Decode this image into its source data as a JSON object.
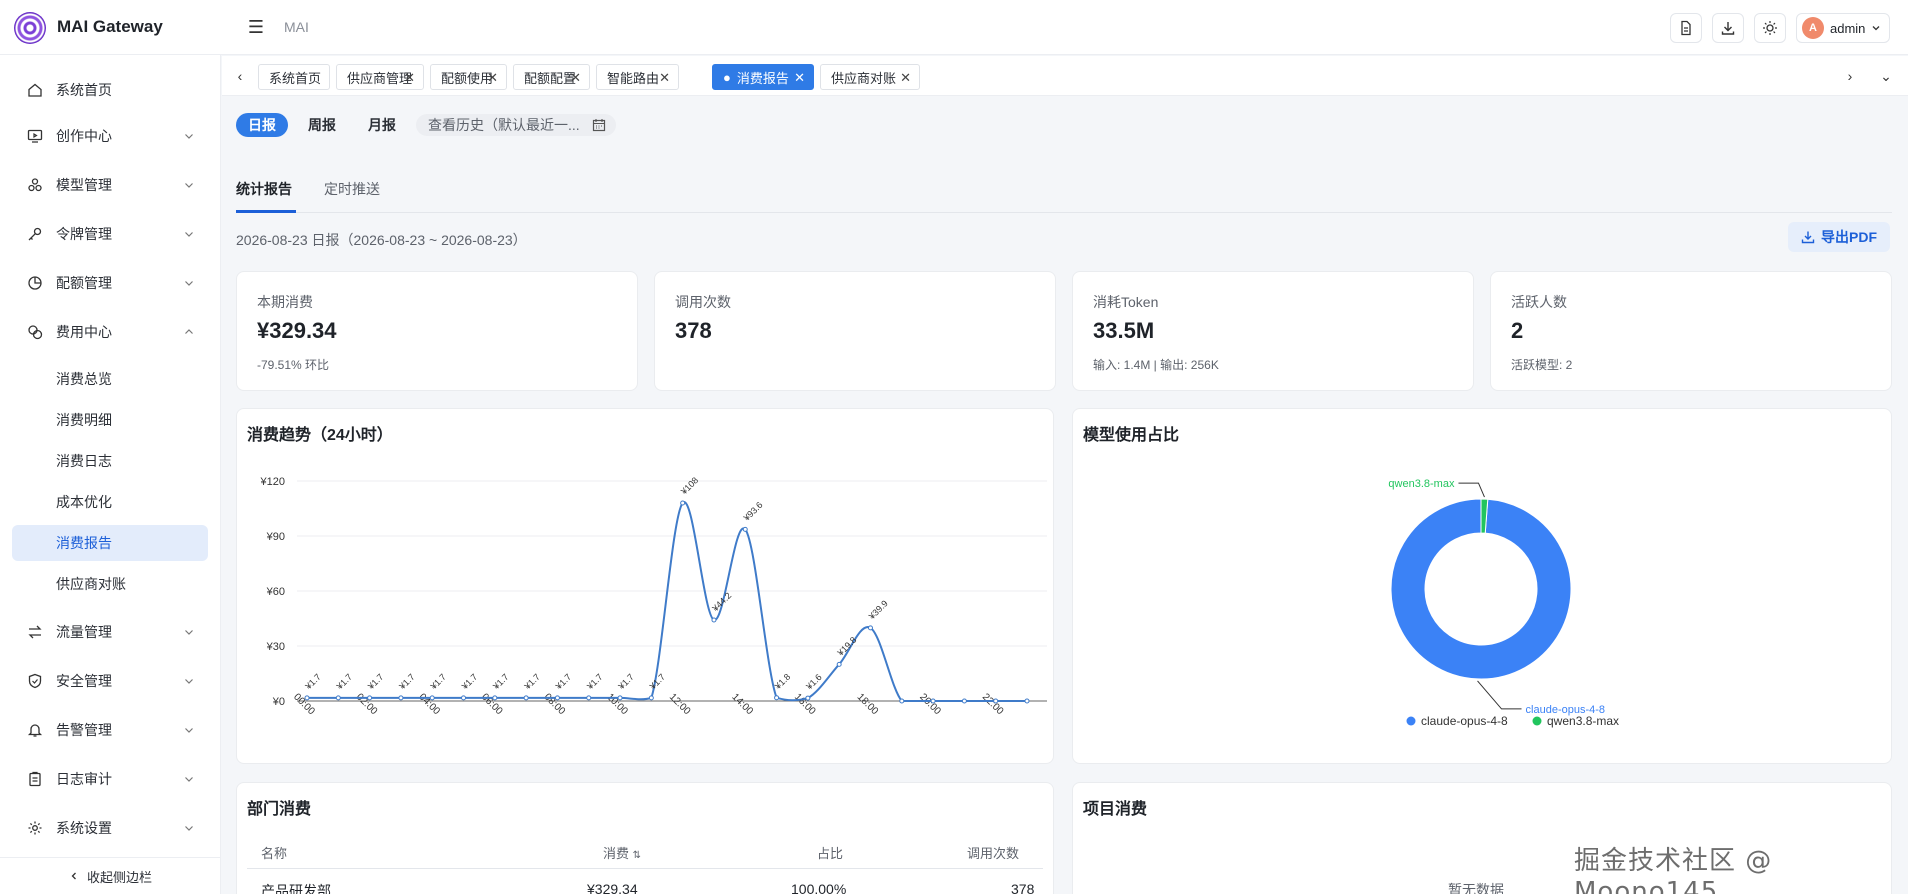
{
  "app": {
    "title": "MAI Gateway",
    "breadcrumb": "MAI"
  },
  "header": {
    "user": "admin",
    "avatar_letter": "A"
  },
  "sidebar": {
    "items": [
      {
        "label": "系统首页",
        "icon": "home-icon"
      },
      {
        "label": "创作中心",
        "icon": "monitor-icon"
      },
      {
        "label": "模型管理",
        "icon": "cluster-icon"
      },
      {
        "label": "令牌管理",
        "icon": "key-icon"
      },
      {
        "label": "配额管理",
        "icon": "pie-icon"
      },
      {
        "label": "费用中心",
        "icon": "coins-icon"
      },
      {
        "label": "流量管理",
        "icon": "swap-icon"
      },
      {
        "label": "安全管理",
        "icon": "shield-icon"
      },
      {
        "label": "告警管理",
        "icon": "bell-icon"
      },
      {
        "label": "日志审计",
        "icon": "clipboard-icon"
      },
      {
        "label": "系统设置",
        "icon": "gear-icon"
      }
    ],
    "sub_items": [
      "消费总览",
      "消费明细",
      "消费日志",
      "成本优化",
      "消费报告",
      "供应商对账"
    ],
    "collapse_label": "收起侧边栏"
  },
  "tabs": [
    "系统首页",
    "供应商管理",
    "配额使用",
    "配额配置",
    "智能路由",
    "消费报告",
    "供应商对账"
  ],
  "periods": [
    "日报",
    "周报",
    "月报"
  ],
  "history_placeholder": "查看历史（默认最近一...",
  "subtabs": [
    "统计报告",
    "定时推送"
  ],
  "report": {
    "range": "2026-08-23 日报（2026-08-23 ~ 2026-08-23）",
    "export_label": "导出PDF"
  },
  "stats": [
    {
      "label": "本期消费",
      "value": "¥329.34",
      "sub": "-79.51% 环比"
    },
    {
      "label": "调用次数",
      "value": "378",
      "sub": ""
    },
    {
      "label": "消耗Token",
      "value": "33.5M",
      "sub": "输入: 1.4M | 输出: 256K"
    },
    {
      "label": "活跃人数",
      "value": "2",
      "sub": "活跃模型: 2"
    }
  ],
  "panels": {
    "trend_title": "消费趋势（24小时）",
    "share_title": "模型使用占比",
    "dept_title": "部门消费",
    "project_title": "项目消费",
    "project_empty": "暂无数据"
  },
  "dept_table": {
    "headers": [
      "名称",
      "消费",
      "占比",
      "调用次数"
    ],
    "rows": [
      [
        "产品研发部",
        "¥329.34",
        "100.00%",
        "378"
      ]
    ]
  },
  "watermark": "掘金技术社区 @ Moono145",
  "colors": {
    "primary": "#2f7be6",
    "line": "#3f7bc9",
    "donut_main": "#3b82f6",
    "donut_minor": "#22c55e"
  },
  "chart_data": [
    {
      "type": "line",
      "title": "消费趋势（24小时）",
      "x": [
        "00:00",
        "01:00",
        "02:00",
        "03:00",
        "04:00",
        "05:00",
        "06:00",
        "07:00",
        "08:00",
        "09:00",
        "10:00",
        "11:00",
        "12:00",
        "13:00",
        "14:00",
        "15:00",
        "16:00",
        "17:00",
        "18:00",
        "19:00",
        "20:00",
        "21:00",
        "22:00",
        "23:00"
      ],
      "x_tick_labels": [
        "00:00",
        "02:00",
        "04:00",
        "06:00",
        "08:00",
        "10:00",
        "12:00",
        "14:00",
        "16:00",
        "18:00",
        "20:00",
        "22:00"
      ],
      "values": [
        1.7,
        1.7,
        1.7,
        1.7,
        1.7,
        1.7,
        1.7,
        1.7,
        1.7,
        1.7,
        1.7,
        1.7,
        108,
        44.2,
        93.6,
        1.8,
        1.6,
        20,
        39.9,
        0,
        0,
        0,
        0,
        0
      ],
      "data_labels": [
        "¥1.7",
        "¥1.7",
        "¥1.7",
        "¥1.7",
        "¥1.7",
        "¥1.7",
        "¥1.7",
        "¥1.7",
        "¥1.7",
        "¥1.7",
        "¥1.7",
        "¥1.7",
        "¥108",
        "¥44.2",
        "¥93.6",
        "¥1.8",
        "¥1.6",
        "¥19.8",
        "¥39.9",
        "",
        "",
        "",
        "",
        ""
      ],
      "y_ticks": [
        "¥0",
        "¥30",
        "¥60",
        "¥90",
        "¥120"
      ],
      "ylim": [
        0,
        120
      ]
    },
    {
      "type": "pie",
      "title": "模型使用占比",
      "labels": [
        "claude-opus-4-8",
        "qwen3.8-max"
      ],
      "values": [
        98.8,
        1.2
      ],
      "legend": "bottom"
    }
  ]
}
